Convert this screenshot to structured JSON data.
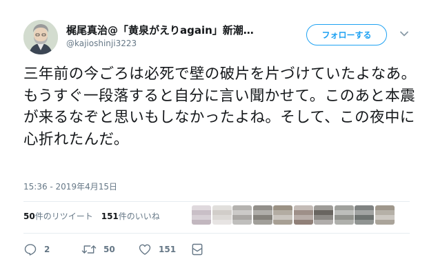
{
  "user": {
    "display_name": "梶尾真治@「黄泉がえりagain」新潮…",
    "handle": "@kajioshinji3223",
    "avatar_icon": "avatar-portrait-icon"
  },
  "follow_button": {
    "label": "フォローする",
    "color": "#1da1f2"
  },
  "menu": {
    "icon": "chevron-down-icon"
  },
  "tweet": {
    "text": "三年前の今ごろは必死で壁の破片を片づけていたよなあ。もうすぐ一段落すると自分に言い聞かせて。このあと本震が来るなぞと思いもしなかったよね。そして、この夜中に心折れたんだ。",
    "timestamp": "15:36 - 2019年4月15日"
  },
  "stats": {
    "retweets_count": "50",
    "retweets_label": "件のリツイート",
    "likes_count": "151",
    "likes_label": "件のいいね"
  },
  "liked_by": [
    {
      "icon": "avatar-blurred-icon",
      "color": "#b7aab4"
    },
    {
      "icon": "avatar-blurred-icon",
      "color": "#c9c4c0"
    },
    {
      "icon": "avatar-blurred-icon",
      "color": "#8d8a86"
    },
    {
      "icon": "avatar-blurred-icon",
      "color": "#6f6b64"
    },
    {
      "icon": "avatar-blurred-icon",
      "color": "#8a7f70"
    },
    {
      "icon": "avatar-blurred-icon",
      "color": "#7d6a60"
    },
    {
      "icon": "avatar-blurred-icon",
      "color": "#4f4a44"
    },
    {
      "icon": "avatar-blurred-icon",
      "color": "#6d6f68"
    },
    {
      "icon": "avatar-blurred-icon",
      "color": "#555a58"
    },
    {
      "icon": "avatar-blurred-icon",
      "color": "#8e8578"
    }
  ],
  "actions": {
    "reply": {
      "icon": "reply-icon",
      "count": "2"
    },
    "retweet": {
      "icon": "retweet-icon",
      "count": "50"
    },
    "like": {
      "icon": "heart-icon",
      "count": "151"
    },
    "dm": {
      "icon": "direct-message-icon"
    }
  }
}
